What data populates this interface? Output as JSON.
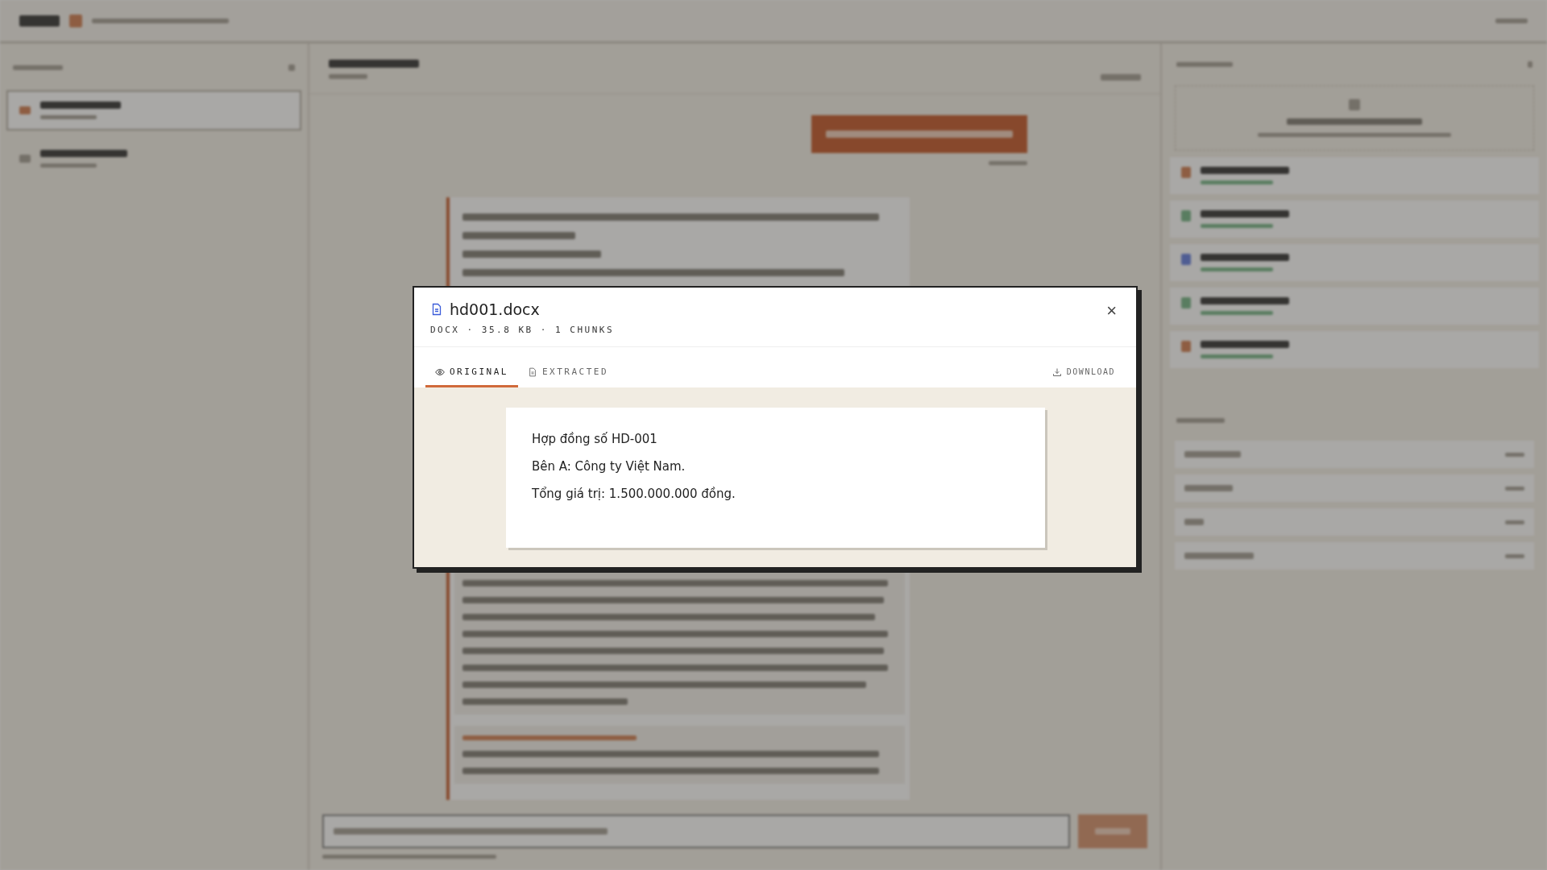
{
  "modal": {
    "title": "hd001.docx",
    "meta": "DOCX · 35.8 KB · 1 CHUNKS",
    "close": "×",
    "tabs": [
      {
        "label": "ORIGINAL",
        "kind": "eye",
        "selected": true
      },
      {
        "label": "EXTRACTED",
        "kind": "doc",
        "selected": false
      }
    ],
    "download": "DOWNLOAD",
    "lines": [
      "Hợp đồng số HD-001",
      "Bên A: Công ty Việt Nam.",
      "Tổng giá trị: 1.500.000.000 đồng."
    ]
  }
}
